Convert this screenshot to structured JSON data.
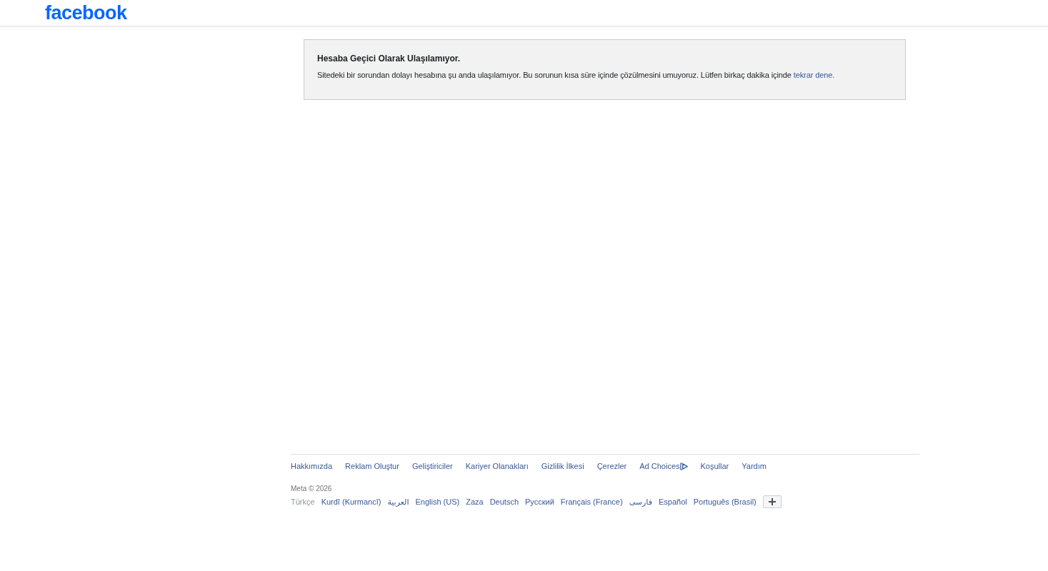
{
  "header": {
    "logo": "facebook"
  },
  "notice": {
    "title": "Hesaba Geçici Olarak Ulaşılamıyor.",
    "message": "Sitedeki bir sorundan dolayı hesabına şu anda ulaşılamıyor. Bu sorunun kısa süre içinde çözülmesini umuyoruz. Lütfen birkaç dakika içinde",
    "link": "tekrar dene."
  },
  "footer": {
    "links": [
      {
        "label": "Hakkımızda",
        "kind": "text"
      },
      {
        "label": "Reklam Oluştur",
        "kind": "text"
      },
      {
        "label": "Geliştiriciler",
        "kind": "text"
      },
      {
        "label": "Kariyer Olanakları",
        "kind": "text"
      },
      {
        "label": "Gizlilik İlkesi",
        "kind": "text"
      },
      {
        "label": "Çerezler",
        "kind": "text"
      },
      {
        "label": "Ad Choices",
        "kind": "adchoices"
      },
      {
        "label": "Koşullar",
        "kind": "text"
      },
      {
        "label": "Yardım",
        "kind": "text"
      }
    ],
    "copyright": "Meta © 2026",
    "languages": [
      {
        "label": "Türkçe",
        "selected": true
      },
      {
        "label": "Kurdî (Kurmancî)",
        "selected": false
      },
      {
        "label": "العربية",
        "selected": false
      },
      {
        "label": "English (US)",
        "selected": false
      },
      {
        "label": "Zaza",
        "selected": false
      },
      {
        "label": "Deutsch",
        "selected": false
      },
      {
        "label": "Русский",
        "selected": false
      },
      {
        "label": "Français (France)",
        "selected": false
      },
      {
        "label": "فارسی",
        "selected": false
      },
      {
        "label": "Español",
        "selected": false
      },
      {
        "label": "Português (Brasil)",
        "selected": false
      }
    ]
  }
}
